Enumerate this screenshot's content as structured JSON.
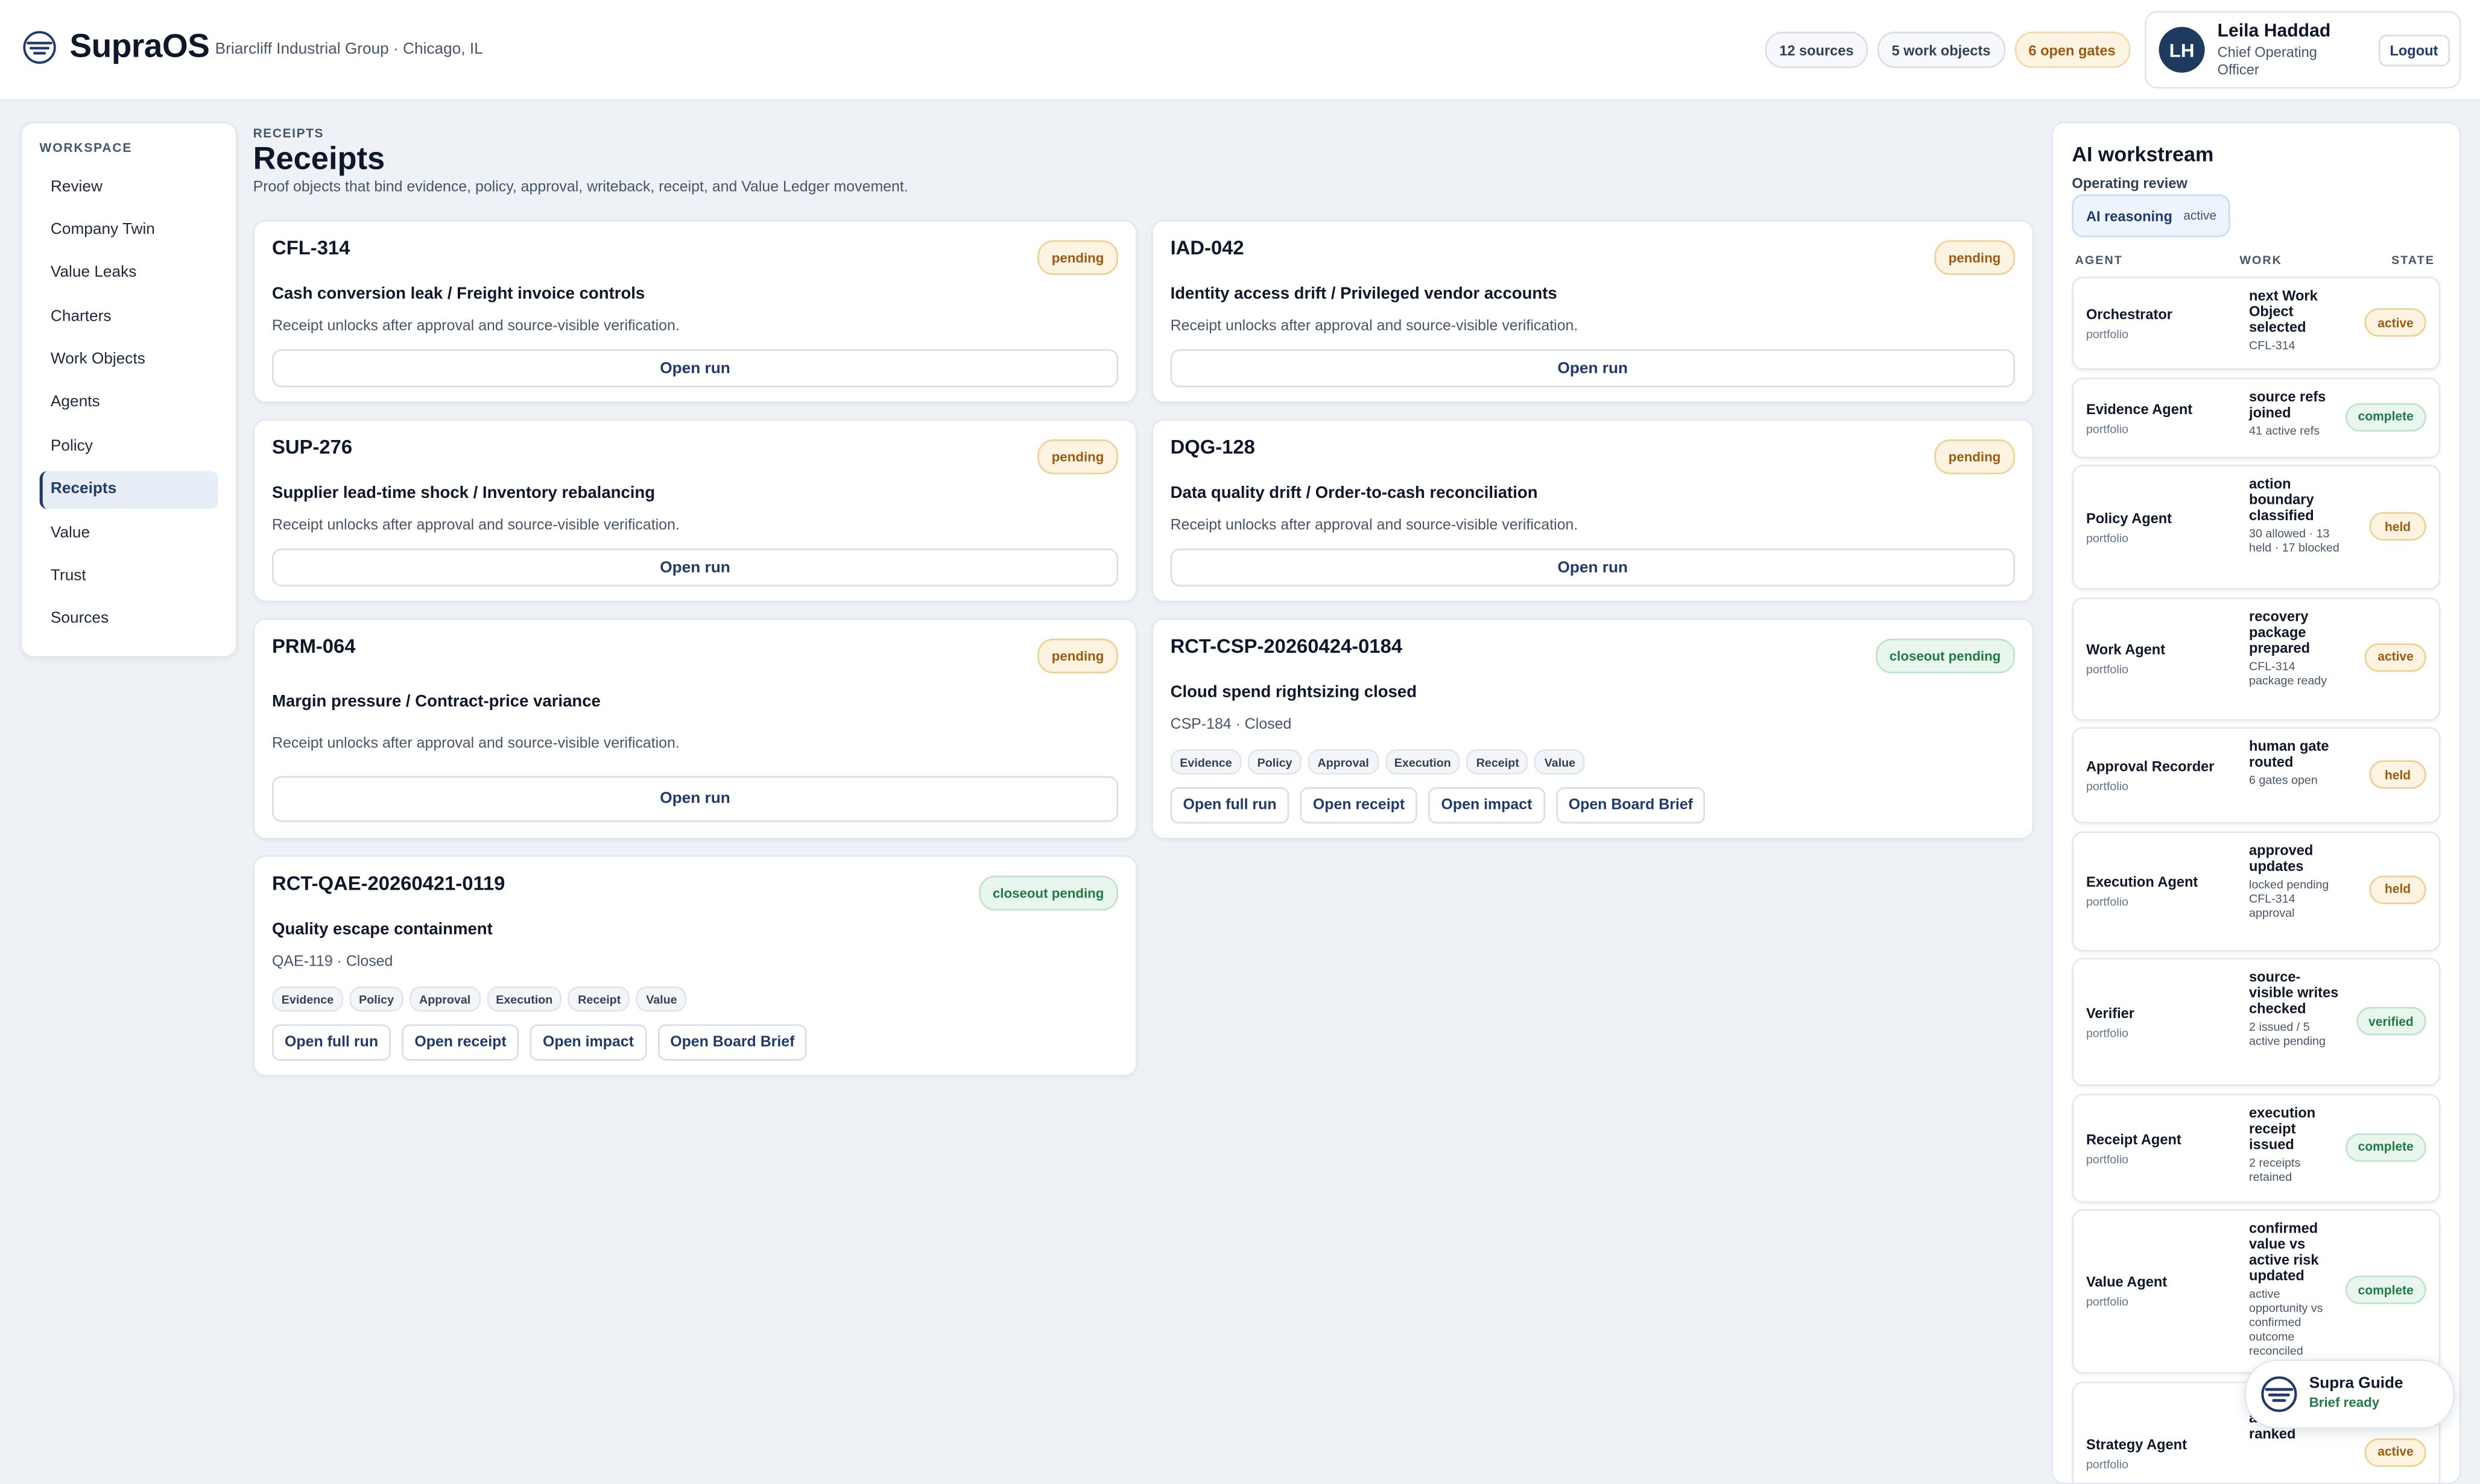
{
  "app": {
    "brand": "SupraOS",
    "org": "Briarcliff Industrial Group · Chicago, IL"
  },
  "header": {
    "chips": [
      "12 sources",
      "5 work objects",
      "6 open gates"
    ],
    "user": {
      "initials": "LH",
      "name": "Leila Haddad",
      "role": "Chief Operating Officer",
      "logout": "Logout"
    }
  },
  "sidebar": {
    "heading": "WORKSPACE",
    "items": [
      "Review",
      "Company Twin",
      "Value Leaks",
      "Charters",
      "Work Objects",
      "Agents",
      "Policy",
      "Receipts",
      "Value",
      "Trust",
      "Sources"
    ],
    "active": "Receipts"
  },
  "page": {
    "breadcrumb": "RECEIPTS",
    "title": "Receipts",
    "subtitle": "Proof objects that bind evidence, policy, approval, writeback, receipt, and Value Ledger movement."
  },
  "cards": [
    {
      "id": "CFL-314",
      "status": "pending",
      "title": "Cash conversion leak / Freight invoice controls",
      "note": "Receipt unlocks after approval and source-visible verification.",
      "button": "Open run"
    },
    {
      "id": "IAD-042",
      "status": "pending",
      "title": "Identity access drift / Privileged vendor accounts",
      "note": "Receipt unlocks after approval and source-visible verification.",
      "button": "Open run"
    },
    {
      "id": "SUP-276",
      "status": "pending",
      "title": "Supplier lead-time shock / Inventory rebalancing",
      "note": "Receipt unlocks after approval and source-visible verification.",
      "button": "Open run"
    },
    {
      "id": "DQG-128",
      "status": "pending",
      "title": "Data quality drift / Order-to-cash reconciliation",
      "note": "Receipt unlocks after approval and source-visible verification.",
      "button": "Open run"
    },
    {
      "id": "PRM-064",
      "status": "pending",
      "title": "Margin pressure / Contract-price variance",
      "note": "Receipt unlocks after approval and source-visible verification.",
      "button": "Open run"
    },
    {
      "id": "RCT-CSP-20260424-0184",
      "status": "closeout pending",
      "title": "Cloud spend rightsizing closed",
      "note": "CSP-184 · Closed",
      "tags": [
        "Evidence",
        "Policy",
        "Approval",
        "Execution",
        "Receipt",
        "Value"
      ],
      "actions": [
        "Open full run",
        "Open receipt",
        "Open impact",
        "Open Board Brief"
      ]
    },
    {
      "id": "RCT-QAE-20260421-0119",
      "status": "closeout pending",
      "title": "Quality escape containment",
      "note": "QAE-119 · Closed",
      "tags": [
        "Evidence",
        "Policy",
        "Approval",
        "Execution",
        "Receipt",
        "Value"
      ],
      "actions": [
        "Open full run",
        "Open receipt",
        "Open impact",
        "Open Board Brief"
      ]
    }
  ],
  "ai": {
    "title": "AI workstream",
    "subtitle": "Operating review",
    "pill_label": "AI reasoning",
    "pill_state": "active",
    "columns": [
      "AGENT",
      "WORK",
      "STATE"
    ],
    "agents": [
      {
        "name": "Orchestrator",
        "scope": "portfolio",
        "work": "next Work Object selected",
        "detail": "CFL-314",
        "state": "active"
      },
      {
        "name": "Evidence Agent",
        "scope": "portfolio",
        "work": "source refs joined",
        "detail": "41 active refs",
        "state": "complete"
      },
      {
        "name": "Policy Agent",
        "scope": "portfolio",
        "work": "action boundary classified",
        "detail": "30 allowed · 13 held · 17 blocked",
        "state": "held"
      },
      {
        "name": "Work Agent",
        "scope": "portfolio",
        "work": "recovery package prepared",
        "detail": "CFL-314 package ready",
        "state": "active"
      },
      {
        "name": "Approval Recorder",
        "scope": "portfolio",
        "work": "human gate routed",
        "detail": "6 gates open",
        "state": "held"
      },
      {
        "name": "Execution Agent",
        "scope": "portfolio",
        "work": "approved updates",
        "detail": "locked pending CFL-314 approval",
        "state": "held"
      },
      {
        "name": "Verifier",
        "scope": "portfolio",
        "work": "source-visible writes checked",
        "detail": "2 issued / 5 active pending",
        "state": "verified"
      },
      {
        "name": "Receipt Agent",
        "scope": "portfolio",
        "work": "execution receipt issued",
        "detail": "2 receipts retained",
        "state": "complete"
      },
      {
        "name": "Value Agent",
        "scope": "portfolio",
        "work": "confirmed value vs active risk updated",
        "detail": "active opportunity vs confirmed outcome reconciled",
        "state": "complete"
      },
      {
        "name": "Strategy Agent",
        "scope": "portfolio",
        "work": "action re-ranked",
        "detail": "",
        "state": "active"
      }
    ]
  },
  "guide": {
    "title": "Supra Guide",
    "status": "Brief ready"
  }
}
